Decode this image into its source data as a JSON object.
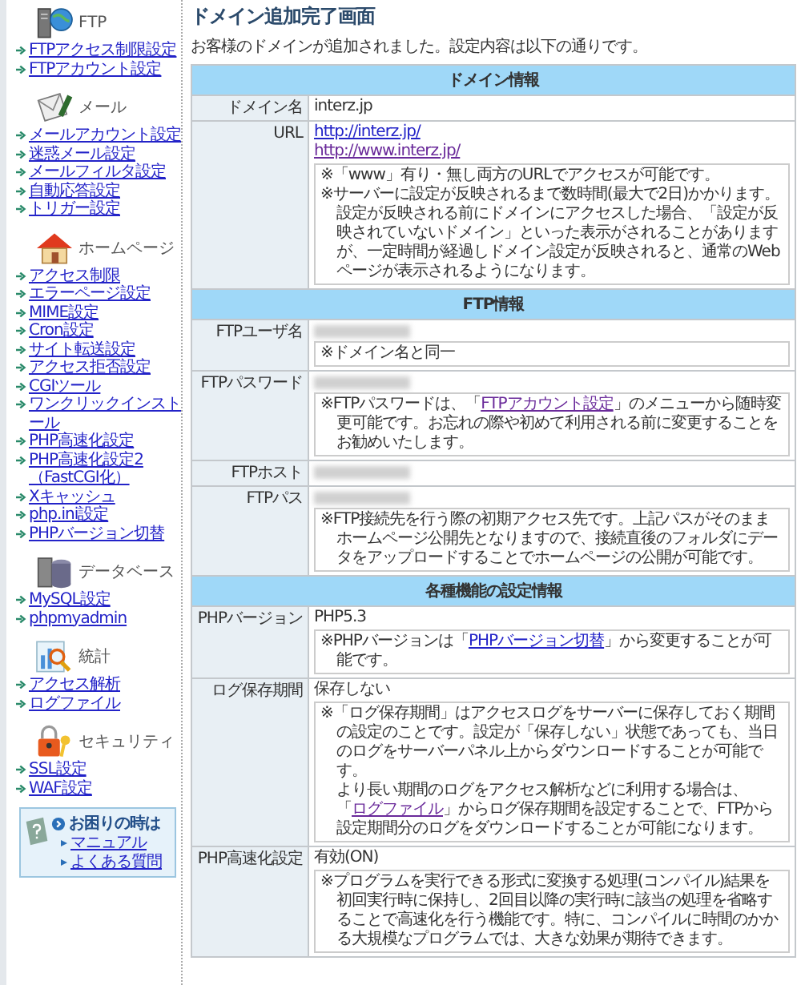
{
  "sidebar": {
    "sections": [
      {
        "kind": "ftp",
        "title": "FTP",
        "items": [
          {
            "label": "FTPアクセス制限設定"
          },
          {
            "label": "FTPアカウント設定"
          }
        ]
      },
      {
        "kind": "mail",
        "title": "メール",
        "items": [
          {
            "label": "メールアカウント設定"
          },
          {
            "label": "迷惑メール設定"
          },
          {
            "label": "メールフィルタ設定"
          },
          {
            "label": "自動応答設定"
          },
          {
            "label": "トリガー設定"
          }
        ]
      },
      {
        "kind": "homepage",
        "title": "ホームページ",
        "items": [
          {
            "label": "アクセス制限"
          },
          {
            "label": "エラーページ設定"
          },
          {
            "label": "MIME設定"
          },
          {
            "label": "Cron設定"
          },
          {
            "label": "サイト転送設定"
          },
          {
            "label": "アクセス拒否設定"
          },
          {
            "label": "CGIツール"
          },
          {
            "label": "ワンクリックインストール"
          },
          {
            "label": "PHP高速化設定"
          },
          {
            "label": "PHP高速化設定2（FastCGI化）"
          },
          {
            "label": "Xキャッシュ"
          },
          {
            "label": "php.ini設定"
          },
          {
            "label": "PHPバージョン切替"
          }
        ]
      },
      {
        "kind": "database",
        "title": "データベース",
        "items": [
          {
            "label": "MySQL設定"
          },
          {
            "label": "phpmyadmin"
          }
        ]
      },
      {
        "kind": "stats",
        "title": "統計",
        "items": [
          {
            "label": "アクセス解析"
          },
          {
            "label": "ログファイル"
          }
        ]
      },
      {
        "kind": "security",
        "title": "セキュリティ",
        "items": [
          {
            "label": "SSL設定"
          },
          {
            "label": "WAF設定"
          }
        ]
      }
    ],
    "help": {
      "title": "お困りの時は",
      "links": [
        "マニュアル",
        "よくある質問"
      ]
    }
  },
  "main": {
    "title": "ドメイン追加完了画面",
    "intro": "お客様のドメインが追加されました。設定内容は以下の通りです。",
    "sections": [
      {
        "title": "ドメイン情報",
        "rows": [
          {
            "label": "ドメイン名",
            "value": "interz.jp"
          },
          {
            "label": "URL",
            "links": [
              {
                "text": "http://interz.jp/",
                "visited": false
              },
              {
                "text": "http://www.interz.jp/",
                "visited": true
              }
            ],
            "note": [
              [
                {
                  "kind": "text",
                  "text": "※「www」有り・無し両方のURLでアクセスが可能です。"
                }
              ],
              [
                {
                  "kind": "text",
                  "text": "※サーバーに設定が反映されるまで数時間(最大で2日)かかります。設定が反映される前にドメインにアクセスした場合、「設定が反映されていないドメイン」といった表示がされることがありますが、一定時間が経過しドメイン設定が反映されると、通常のWebページが表示されるようになります。"
                }
              ]
            ]
          }
        ]
      },
      {
        "title": "FTP情報",
        "rows": [
          {
            "label": "FTPユーザ名",
            "redacted": true,
            "note": [
              [
                {
                  "kind": "text",
                  "text": "※ドメイン名と同一"
                }
              ]
            ]
          },
          {
            "label": "FTPパスワード",
            "redacted": true,
            "note": [
              [
                {
                  "kind": "text",
                  "text": "※FTPパスワードは、「"
                },
                {
                  "kind": "link",
                  "text": "FTPアカウント設定",
                  "visited": true
                },
                {
                  "kind": "text",
                  "text": "」のメニューから随時変更可能です。お忘れの際や初めて利用される前に変更することをお勧めいたします。"
                }
              ]
            ]
          },
          {
            "label": "FTPホスト",
            "redacted": true
          },
          {
            "label": "FTPパス",
            "redacted": true,
            "note": [
              [
                {
                  "kind": "text",
                  "text": "※FTP接続先を行う際の初期アクセス先です。上記パスがそのままホームページ公開先となりますので、接続直後のフォルダにデータをアップロードすることでホームページの公開が可能です。"
                }
              ]
            ]
          }
        ]
      },
      {
        "title": "各種機能の設定情報",
        "rows": [
          {
            "label": "PHPバージョン",
            "value": "PHP5.3",
            "note": [
              [
                {
                  "kind": "text",
                  "text": "※PHPバージョンは「"
                },
                {
                  "kind": "link",
                  "text": "PHPバージョン切替",
                  "visited": false
                },
                {
                  "kind": "text",
                  "text": "」から変更することが可能です。"
                }
              ]
            ]
          },
          {
            "label": "ログ保存期間",
            "value": "保存しない",
            "note": [
              [
                {
                  "kind": "text",
                  "text": "※「ログ保存期間」はアクセスログをサーバーに保存しておく期間の設定のことです。設定が「保存しない」状態であっても、当日のログをサーバーパネル上からダウンロードすることが可能です。"
                }
              ],
              [
                {
                  "kind": "text",
                  "text": "より長い期間のログをアクセス解析などに利用する場合は、「"
                },
                {
                  "kind": "link",
                  "text": "ログファイル",
                  "visited": true
                },
                {
                  "kind": "text",
                  "text": "」からログ保存期間を設定することで、FTPから設定期間分のログをダウンロードすることが可能になります。"
                }
              ]
            ]
          },
          {
            "label": "PHP高速化設定",
            "value": "有効(ON)",
            "note": [
              [
                {
                  "kind": "text",
                  "text": "※プログラムを実行できる形式に変換する処理(コンパイル)結果を初回実行時に保持し、2回目以降の実行時に該当の処理を省略することで高速化を行う機能です。特に、コンパイルに時間のかかる大規模なプログラムでは、大きな効果が期待できます。"
                }
              ]
            ]
          }
        ]
      }
    ]
  }
}
